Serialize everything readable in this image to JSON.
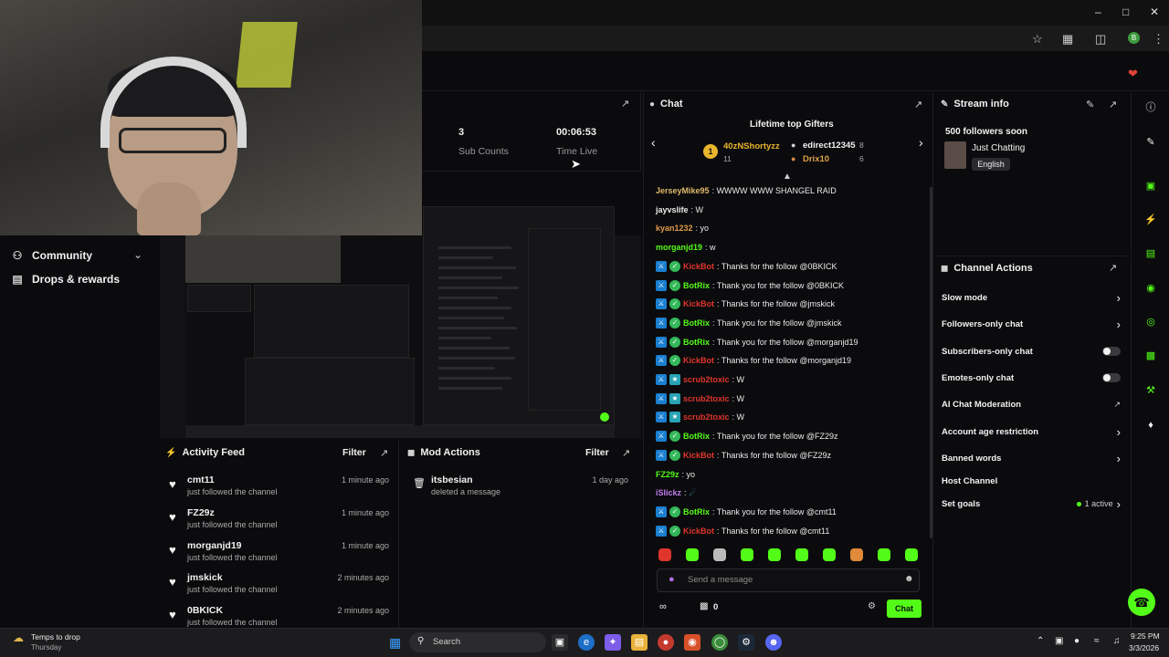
{
  "stats": {
    "sub_counts_value": "3",
    "sub_counts_label": "Sub Counts",
    "time_live_value": "00:06:53",
    "time_live_label": "Time Live"
  },
  "sidebar": {
    "items": [
      {
        "label": "Community",
        "icon": "people-icon"
      },
      {
        "label": "Drops & rewards",
        "icon": "gift-icon"
      }
    ]
  },
  "activity_feed": {
    "title": "Activity Feed",
    "filter_label": "Filter",
    "items": [
      {
        "name": "cmt11",
        "action": "just followed the channel",
        "time": "1 minute ago"
      },
      {
        "name": "FZ29z",
        "action": "just followed the channel",
        "time": "1 minute ago"
      },
      {
        "name": "morganjd19",
        "action": "just followed the channel",
        "time": "1 minute ago"
      },
      {
        "name": "jmskick",
        "action": "just followed the channel",
        "time": "2 minutes ago"
      },
      {
        "name": "0BKICK",
        "action": "just followed the channel",
        "time": "2 minutes ago"
      }
    ]
  },
  "mod_actions": {
    "title": "Mod Actions",
    "filter_label": "Filter",
    "items": [
      {
        "name": "itsbesian",
        "action": "deleted a message",
        "time": "1 day ago"
      }
    ]
  },
  "chat": {
    "title": "Chat",
    "gifters_title": "Lifetime top Gifters",
    "gifters": [
      {
        "name": "40zNShortyzz",
        "count": "11"
      },
      {
        "name": "edirect12345",
        "count": "8"
      },
      {
        "name": "Drix10",
        "count": "6"
      }
    ],
    "messages": [
      {
        "user": "JerseyMike95",
        "text": ": WWWW WWW SHANGEL RAID",
        "color": "#e0b86a",
        "badges": []
      },
      {
        "user": "jayvslife",
        "text": ": W",
        "color": "#eaeaea",
        "badges": []
      },
      {
        "user": "kyan1232",
        "text": ": yo",
        "color": "#e09a4a",
        "badges": []
      },
      {
        "user": "morganjd19",
        "text": ": w",
        "color": "#53fc18",
        "badges": []
      },
      {
        "user": "KickBot",
        "text": ": Thanks for the follow @0BKICK",
        "color": "#e0352b",
        "badges": [
          "mod",
          "ver"
        ]
      },
      {
        "user": "BotRix",
        "text": ": Thank you for the follow @0BKICK",
        "color": "#53fc18",
        "badges": [
          "mod",
          "ver"
        ]
      },
      {
        "user": "KickBot",
        "text": ": Thanks for the follow @jmskick",
        "color": "#e0352b",
        "badges": [
          "mod",
          "ver"
        ]
      },
      {
        "user": "BotRix",
        "text": ": Thank you for the follow @jmskick",
        "color": "#53fc18",
        "badges": [
          "mod",
          "ver"
        ]
      },
      {
        "user": "BotRix",
        "text": ": Thank you for the follow @morganjd19",
        "color": "#53fc18",
        "badges": [
          "mod",
          "ver"
        ]
      },
      {
        "user": "KickBot",
        "text": ": Thanks for the follow @morganjd19",
        "color": "#e0352b",
        "badges": [
          "mod",
          "ver"
        ]
      },
      {
        "user": "scrub2toxic",
        "text": ": W",
        "color": "#e0352b",
        "badges": [
          "mod",
          "sub"
        ]
      },
      {
        "user": "scrub2toxic",
        "text": ": W",
        "color": "#e0352b",
        "badges": [
          "mod",
          "sub"
        ]
      },
      {
        "user": "scrub2toxic",
        "text": ": W",
        "color": "#e0352b",
        "badges": [
          "mod",
          "sub"
        ]
      },
      {
        "user": "BotRix",
        "text": ": Thank you for the follow @FZ29z",
        "color": "#53fc18",
        "badges": [
          "mod",
          "ver"
        ]
      },
      {
        "user": "KickBot",
        "text": ": Thanks for the follow @FZ29z",
        "color": "#e0352b",
        "badges": [
          "mod",
          "ver"
        ]
      },
      {
        "user": "FZ29z",
        "text": ": yo",
        "color": "#53fc18",
        "badges": []
      },
      {
        "user": "iSlickz",
        "text": ":",
        "color": "#c07cf0",
        "badges": []
      },
      {
        "user": "BotRix",
        "text": ": Thank you for the follow @cmt11",
        "color": "#53fc18",
        "badges": [
          "mod",
          "ver"
        ]
      },
      {
        "user": "KickBot",
        "text": ": Thanks for the follow @cmt11",
        "color": "#e0352b",
        "badges": [
          "mod",
          "ver"
        ]
      }
    ],
    "input_placeholder": "Send a message",
    "send_label": "Chat",
    "points_value": "0"
  },
  "stream_info": {
    "title_label": "Stream info",
    "stream_title": "500 followers soon",
    "category": "Just Chatting",
    "language": "English"
  },
  "channel_actions": {
    "title": "Channel Actions",
    "items": [
      {
        "label": "Slow mode",
        "control": "arrow"
      },
      {
        "label": "Followers-only chat",
        "control": "arrow"
      },
      {
        "label": "Subscribers-only chat",
        "control": "toggle"
      },
      {
        "label": "Emotes-only chat",
        "control": "toggle"
      },
      {
        "label": "AI Chat Moderation",
        "control": "external"
      },
      {
        "label": "Account age restriction",
        "control": "arrow"
      },
      {
        "label": "Banned words",
        "control": "arrow"
      },
      {
        "label": "Host Channel",
        "control": "none"
      },
      {
        "label": "Set goals",
        "control": "arrow",
        "status": "1 active"
      }
    ]
  },
  "taskbar": {
    "weather_title": "Temps to drop",
    "weather_sub": "Thursday",
    "search_placeholder": "Search",
    "time": "9:25 PM",
    "date": "3/3/2026"
  },
  "colors": {
    "accent": "#53fc18",
    "background": "#0b0b0d"
  }
}
